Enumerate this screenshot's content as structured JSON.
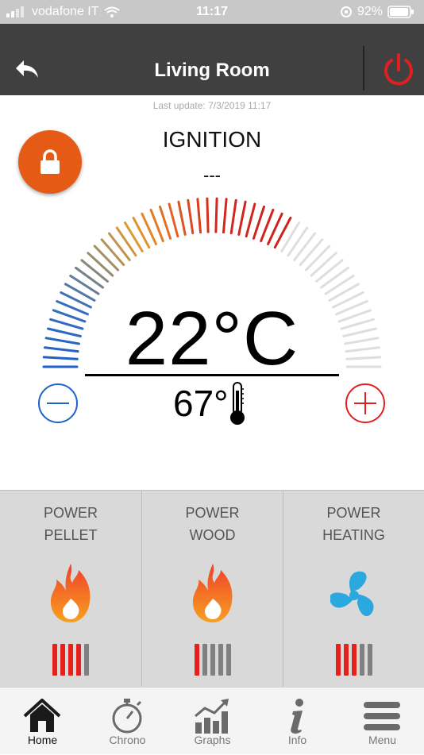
{
  "status_bar": {
    "carrier": "vodafone IT",
    "time": "11:17",
    "battery": "92%"
  },
  "header": {
    "title": "Living Room"
  },
  "last_update": "Last update: 7/3/2019 11:17",
  "state": {
    "label": "IGNITION",
    "sub": "---"
  },
  "thermostat": {
    "set_temp": "22°C",
    "current_temp": "67°",
    "level_fraction": 0.67
  },
  "panels": [
    {
      "line1": "POWER",
      "line2": "PELLET",
      "icon": "flame-icon",
      "level": 4,
      "max": 5
    },
    {
      "line1": "POWER",
      "line2": "WOOD",
      "icon": "flame-icon",
      "level": 1,
      "max": 5
    },
    {
      "line1": "POWER",
      "line2": "HEATING",
      "icon": "fan-icon",
      "level": 3,
      "max": 5
    }
  ],
  "tabs": [
    {
      "label": "Home",
      "icon": "home-icon",
      "active": true
    },
    {
      "label": "Chrono",
      "icon": "stopwatch-icon",
      "active": false
    },
    {
      "label": "Graphs",
      "icon": "graph-icon",
      "active": false
    },
    {
      "label": "Info",
      "icon": "info-icon",
      "active": false
    },
    {
      "label": "Menu",
      "icon": "menu-icon",
      "active": false
    }
  ],
  "colors": {
    "header": "#404040",
    "accent_orange": "#e55a15",
    "power_red": "#e02020",
    "bar_active": "#e8201c",
    "bar_inactive": "#808080",
    "gauge_cold": "#1e63c8",
    "gauge_hot": "#d42a1e",
    "fan_blue": "#2ba8de"
  }
}
